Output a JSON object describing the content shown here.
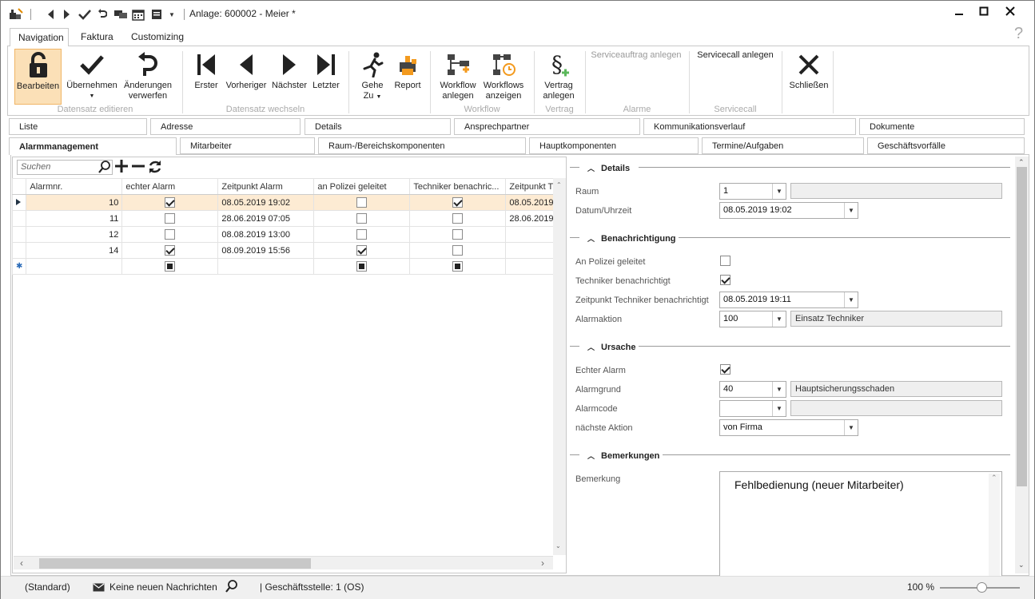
{
  "window": {
    "title": "Anlage: 600002 - Meier *",
    "help": "?"
  },
  "ribbon_tabs": [
    {
      "label": "Navigation",
      "active": true
    },
    {
      "label": "Faktura",
      "active": false
    },
    {
      "label": "Customizing",
      "active": false
    }
  ],
  "ribbon": {
    "edit": {
      "label": "Bearbeiten"
    },
    "apply": {
      "label": "Übernehmen"
    },
    "discard": {
      "label1": "Änderungen",
      "label2": "verwerfen"
    },
    "group_edit": "Datensatz editieren",
    "first": {
      "label": "Erster"
    },
    "prev": {
      "label": "Vorheriger"
    },
    "next": {
      "label": "Nächster"
    },
    "last": {
      "label": "Letzter"
    },
    "group_nav": "Datensatz wechseln",
    "goto": {
      "label1": "Gehe",
      "label2": "Zu"
    },
    "report": {
      "label": "Report"
    },
    "wf_create": {
      "label1": "Workflow",
      "label2": "anlegen"
    },
    "wf_show": {
      "label1": "Workflows",
      "label2": "anzeigen"
    },
    "group_workflow": "Workflow",
    "contract": {
      "label1": "Vertrag",
      "label2": "anlegen"
    },
    "group_contract": "Vertrag",
    "service_order": {
      "label": "Serviceauftrag anlegen"
    },
    "group_alarm": "Alarme",
    "service_call": {
      "label": "Servicecall anlegen"
    },
    "group_servicecall": "Servicecall",
    "close": {
      "label": "Schließen"
    }
  },
  "tabs_row1": [
    "Liste",
    "Adresse",
    "Details",
    "Ansprechpartner",
    "Kommunikationsverlauf",
    "Dokumente"
  ],
  "tabs_row2": [
    "Alarmmanagement",
    "Mitarbeiter",
    "Raum-/Bereichskomponenten",
    "Hauptkomponenten",
    "Termine/Aufgaben",
    "Geschäftsvorfälle"
  ],
  "grid": {
    "search_placeholder": "Suchen",
    "columns": [
      "Alarmnr.",
      "echter Alarm",
      "Zeitpunkt Alarm",
      "an Polizei geleitet",
      "Techniker benachric...",
      "Zeitpunkt T"
    ],
    "rows": [
      {
        "nr": "10",
        "echt": true,
        "zeit": "08.05.2019 19:02",
        "polizei": false,
        "techniker": true,
        "zeit_t": "08.05.2019"
      },
      {
        "nr": "11",
        "echt": false,
        "zeit": "28.06.2019 07:05",
        "polizei": false,
        "techniker": false,
        "zeit_t": "28.06.2019"
      },
      {
        "nr": "12",
        "echt": false,
        "zeit": "08.08.2019 13:00",
        "polizei": false,
        "techniker": false,
        "zeit_t": ""
      },
      {
        "nr": "14",
        "echt": true,
        "zeit": "08.09.2019 15:56",
        "polizei": true,
        "techniker": false,
        "zeit_t": ""
      }
    ]
  },
  "form": {
    "details": {
      "title": "Details",
      "raum_label": "Raum",
      "raum_value": "1",
      "raum_text": "",
      "datum_label": "Datum/Uhrzeit",
      "datum_value": "08.05.2019 19:02"
    },
    "benachrichtigung": {
      "title": "Benachrichtigung",
      "polizei_label": "An Polizei geleitet",
      "techniker_label": "Techniker benachrichtigt",
      "zeit_label": "Zeitpunkt Techniker benachrichtigt",
      "zeit_value": "08.05.2019 19:11",
      "aktion_label": "Alarmaktion",
      "aktion_value": "100",
      "aktion_text": "Einsatz Techniker"
    },
    "ursache": {
      "title": "Ursache",
      "echt_label": "Echter Alarm",
      "grund_label": "Alarmgrund",
      "grund_value": "40",
      "grund_text": "Hauptsicherungsschaden",
      "code_label": "Alarmcode",
      "code_value": "",
      "code_text": "",
      "naechste_label": "nächste Aktion",
      "naechste_value": "von Firma"
    },
    "bemerkungen": {
      "title": "Bemerkungen",
      "label": "Bemerkung",
      "value": "Fehlbedienung (neuer Mitarbeiter)"
    }
  },
  "status": {
    "profile": "(Standard)",
    "messages": "Keine neuen Nachrichten",
    "office": "| Geschäftsstelle:  1 (OS)",
    "zoom": "100 %",
    "zoom_value": 0.52
  },
  "colors": {
    "accent": "#f0b566",
    "selected_row": "#fdebd3",
    "wf_orange": "#f39a1e",
    "green_plus": "#5cb85c"
  }
}
